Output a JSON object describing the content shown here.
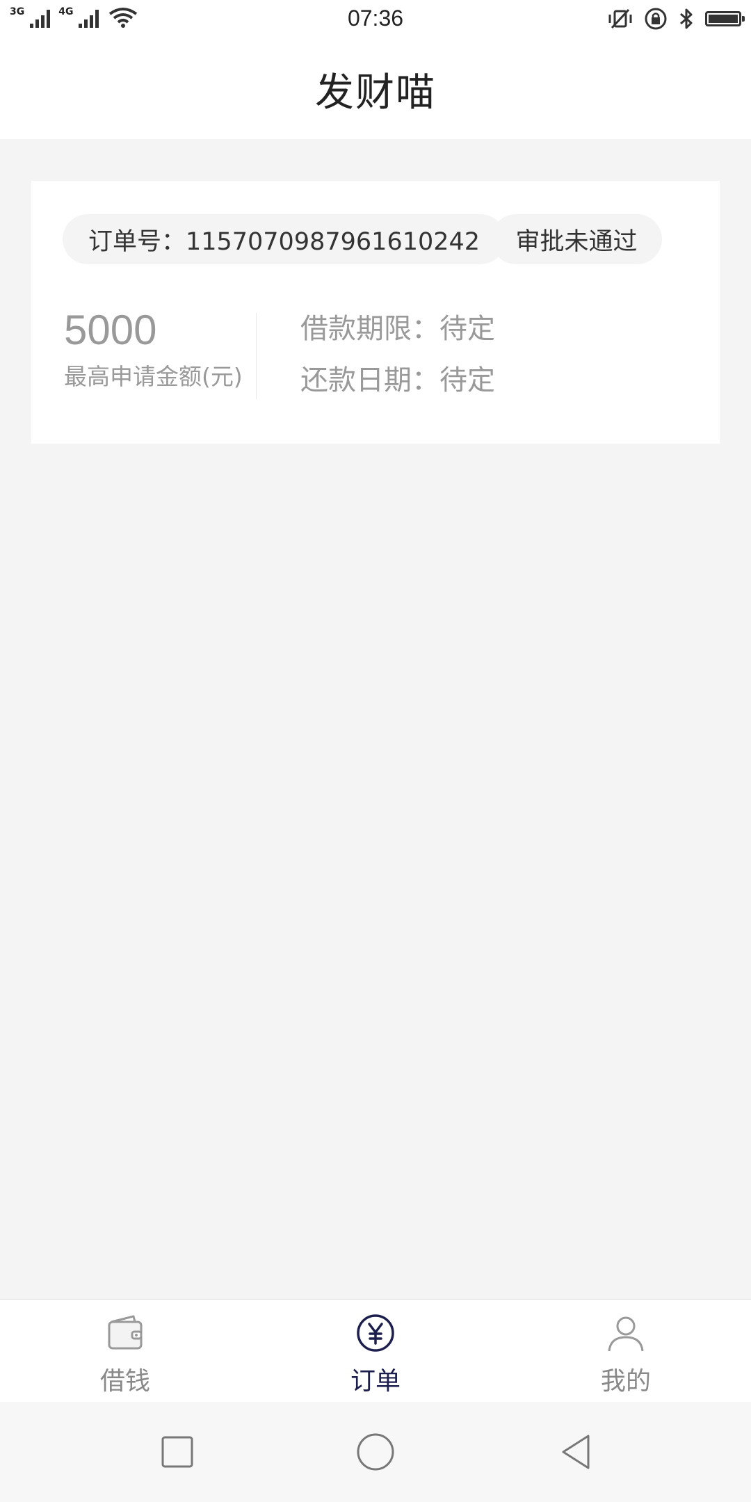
{
  "status_bar": {
    "network_1": "3G",
    "network_2": "4G",
    "time": "07:36"
  },
  "title_bar": {
    "title": "发财喵"
  },
  "order_card": {
    "order_number": "订单号：1157070987961610242",
    "status": "审批未通过",
    "amount_value": "5000",
    "amount_label": "最高申请金额(元)",
    "loan_term": "借款期限：待定",
    "repay_date": "还款日期：待定"
  },
  "tab_bar": {
    "active_color": "#1c1e4e",
    "inactive_color": "#888888",
    "tabs": [
      {
        "label": "借钱",
        "icon": "wallet-icon"
      },
      {
        "label": "订单",
        "icon": "yuan-circle-icon"
      },
      {
        "label": "我的",
        "icon": "person-icon"
      }
    ],
    "active_index": 1
  },
  "nav_bar": {
    "buttons": [
      "recent-apps",
      "home",
      "back"
    ]
  }
}
